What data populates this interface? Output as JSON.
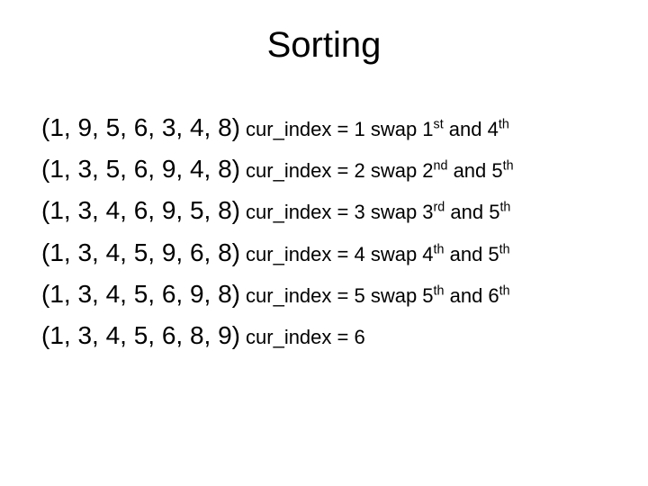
{
  "title": "Sorting",
  "rows": [
    {
      "sequence": "(1, 9, 5, 6, 3, 4, 8)",
      "prefix": " cur_index = 1 swap 1",
      "sup1": "st",
      "mid": " and 4",
      "sup2": "th",
      "suffix": ""
    },
    {
      "sequence": "(1, 3, 5, 6, 9, 4, 8)",
      "prefix": " cur_index = 2 swap 2",
      "sup1": "nd",
      "mid": " and 5",
      "sup2": "th",
      "suffix": ""
    },
    {
      "sequence": "(1, 3, 4, 6, 9, 5, 8)",
      "prefix": " cur_index = 3 swap 3",
      "sup1": "rd",
      "mid": " and 5",
      "sup2": "th",
      "suffix": ""
    },
    {
      "sequence": "(1, 3, 4, 5, 9, 6, 8)",
      "prefix": " cur_index = 4 swap 4",
      "sup1": "th",
      "mid": " and 5",
      "sup2": "th",
      "suffix": ""
    },
    {
      "sequence": "(1, 3, 4, 5, 6, 9, 8)",
      "prefix": " cur_index = 5 swap 5",
      "sup1": "th",
      "mid": "  and 6",
      "sup2": "th",
      "suffix": ""
    },
    {
      "sequence": "(1, 3, 4, 5, 6, 8, 9)",
      "prefix": " cur_index = 6",
      "sup1": "",
      "mid": "",
      "sup2": "",
      "suffix": ""
    }
  ]
}
